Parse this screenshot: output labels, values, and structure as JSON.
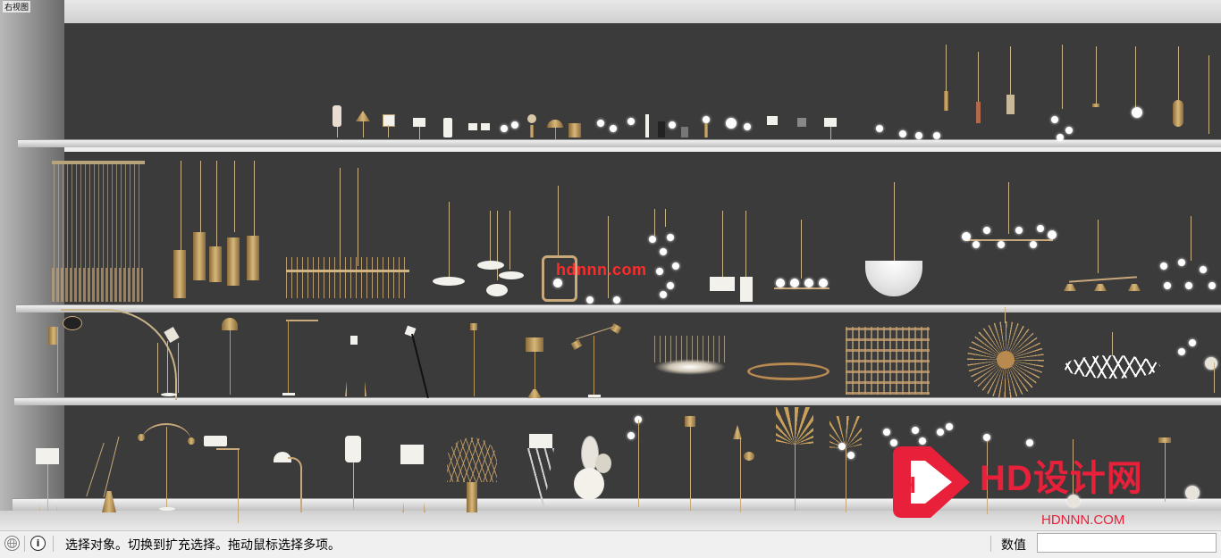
{
  "viewport": {
    "label": "右视图",
    "watermark": "hdnnn.com",
    "logo_text": "HD设计网",
    "logo_url": "HDNNN.COM",
    "logo_letter": "H",
    "accent_color": "#e8203a"
  },
  "statusbar": {
    "geo_icon": "globe-icon",
    "info_icon": "info-icon",
    "info_glyph": "i",
    "message": "选择对象。切换到扩充选择。拖动鼠标选择多项。",
    "measurements_label": "数值",
    "measurements_value": ""
  }
}
